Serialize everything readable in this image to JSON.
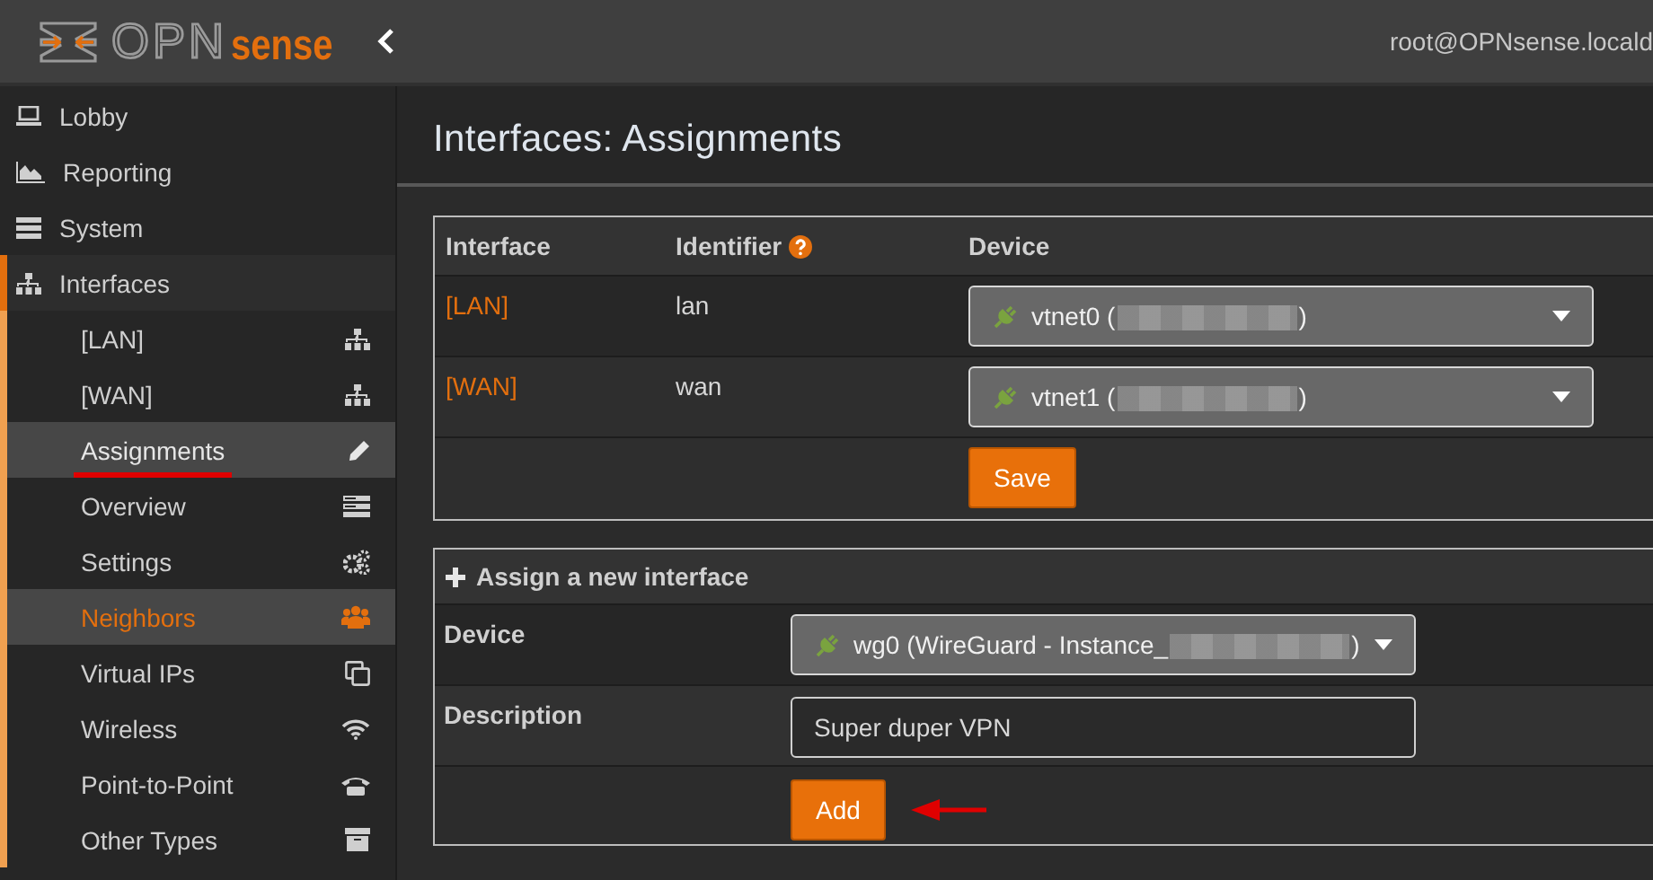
{
  "header": {
    "logo": {
      "mark": "OPN",
      "brand": "sense"
    },
    "user": "root@OPNsense.locald"
  },
  "sidebar": {
    "items": [
      {
        "label": "Lobby",
        "expanded": false
      },
      {
        "label": "Reporting",
        "expanded": false
      },
      {
        "label": "System",
        "expanded": false
      },
      {
        "label": "Interfaces",
        "expanded": true,
        "children": [
          {
            "label": "[LAN]",
            "selected": false,
            "highlighted": false,
            "underlined": false
          },
          {
            "label": "[WAN]",
            "selected": false,
            "highlighted": false,
            "underlined": false
          },
          {
            "label": "Assignments",
            "selected": true,
            "highlighted": false,
            "underlined": true
          },
          {
            "label": "Overview",
            "selected": false,
            "highlighted": false,
            "underlined": false
          },
          {
            "label": "Settings",
            "selected": false,
            "highlighted": false,
            "underlined": false
          },
          {
            "label": "Neighbors",
            "selected": false,
            "highlighted": true,
            "underlined": false
          },
          {
            "label": "Virtual IPs",
            "selected": false,
            "highlighted": false,
            "underlined": false
          },
          {
            "label": "Wireless",
            "selected": false,
            "highlighted": false,
            "underlined": false
          },
          {
            "label": "Point-to-Point",
            "selected": false,
            "highlighted": false,
            "underlined": false
          },
          {
            "label": "Other Types",
            "selected": false,
            "highlighted": false,
            "underlined": false
          }
        ]
      }
    ]
  },
  "main": {
    "title": "Interfaces: Assignments",
    "interfaces_table": {
      "columns": [
        {
          "label": "Interface",
          "help": false
        },
        {
          "label": "Identifier",
          "help": true
        },
        {
          "label": "Device",
          "help": false
        }
      ],
      "rows": [
        {
          "interface": "[LAN]",
          "identifier": "lan",
          "device": {
            "label": "vtnet0 (",
            "suffix": ")"
          }
        },
        {
          "interface": "[WAN]",
          "identifier": "wan",
          "device": {
            "label": "vtnet1 (",
            "suffix": ")"
          }
        }
      ],
      "save_button": "Save"
    },
    "assign_form": {
      "title": "Assign a new interface",
      "fields": [
        {
          "kind": "select",
          "label": "Device",
          "value": "wg0 (WireGuard - Instance_",
          "suffix": ")"
        },
        {
          "kind": "text",
          "label": "Description",
          "value": "Super duper VPN"
        }
      ],
      "add_button": {
        "label": "Add",
        "arrow": true
      }
    }
  }
}
